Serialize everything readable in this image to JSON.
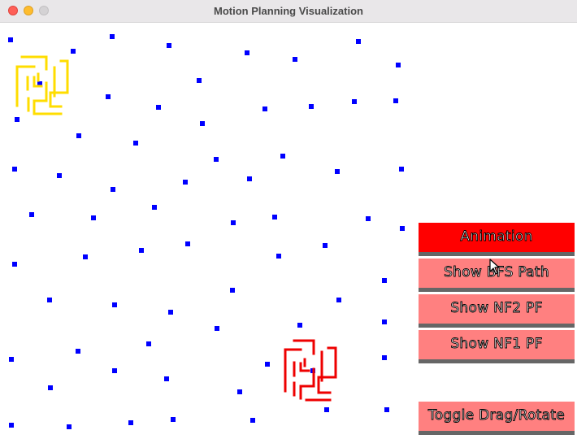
{
  "window": {
    "title": "Motion Planning Visualization"
  },
  "colors": {
    "obstacle_point": "#0000ff",
    "start_robot": "#ffdd00",
    "goal_robot": "#ee0000",
    "button_active": "#ff0000",
    "button_inactive": "#ff8080",
    "button_shadow": "#666666"
  },
  "buttons": [
    {
      "label": "Animation",
      "state": "active"
    },
    {
      "label": "Show BFS Path",
      "state": "inactive"
    },
    {
      "label": "Show NF2 PF",
      "state": "inactive"
    },
    {
      "label": "Show NF1 PF",
      "state": "inactive"
    },
    {
      "label": "Toggle Drag/Rotate",
      "state": "inactive"
    }
  ]
}
